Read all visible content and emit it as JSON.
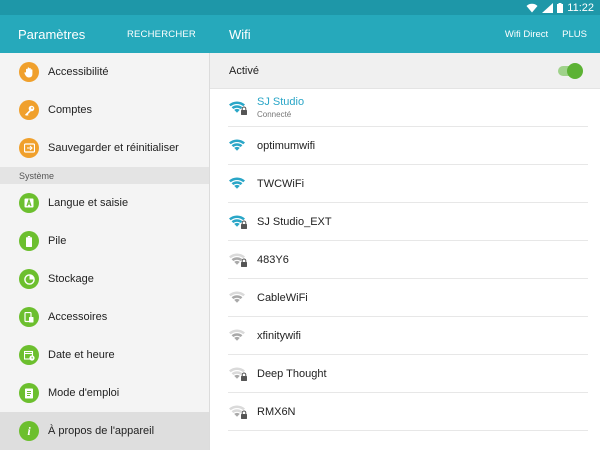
{
  "status_bar": {
    "time": "11:22",
    "bg": "#1e97a8"
  },
  "left_header": {
    "title": "Paramètres",
    "search_label": "RECHERCHER"
  },
  "right_header": {
    "title": "Wifi",
    "wifi_direct_label": "Wifi Direct",
    "more_label": "PLUS"
  },
  "sidebar": {
    "items_top": [
      {
        "label": "Accessibilité",
        "icon": "hand-icon",
        "color": "orange"
      },
      {
        "label": "Comptes",
        "icon": "key-icon",
        "color": "orange"
      },
      {
        "label": "Sauvegarder et réinitialiser",
        "icon": "backup-icon",
        "color": "orange"
      }
    ],
    "section_label": "Système",
    "items_system": [
      {
        "label": "Langue et saisie",
        "icon": "language-icon",
        "color": "green"
      },
      {
        "label": "Pile",
        "icon": "battery-icon",
        "color": "green"
      },
      {
        "label": "Stockage",
        "icon": "storage-icon",
        "color": "green"
      },
      {
        "label": "Accessoires",
        "icon": "accessories-icon",
        "color": "green"
      },
      {
        "label": "Date et heure",
        "icon": "calendar-icon",
        "color": "green"
      },
      {
        "label": "Mode d'emploi",
        "icon": "manual-icon",
        "color": "green"
      },
      {
        "label": "À propos de l'appareil",
        "icon": "info-icon",
        "color": "green",
        "active": true
      }
    ]
  },
  "wifi": {
    "toggle_label": "Activé",
    "enabled": true,
    "networks": [
      {
        "name": "SJ Studio",
        "status": "Connecté",
        "secured": true,
        "strength": 3,
        "connected": true
      },
      {
        "name": "optimumwifi",
        "status": "",
        "secured": false,
        "strength": 3,
        "connected": false
      },
      {
        "name": "TWCWiFi",
        "status": "",
        "secured": false,
        "strength": 3,
        "connected": false
      },
      {
        "name": "SJ Studio_EXT",
        "status": "",
        "secured": true,
        "strength": 3,
        "connected": false
      },
      {
        "name": "483Y6",
        "status": "",
        "secured": true,
        "strength": 2,
        "connected": false
      },
      {
        "name": "CableWiFi",
        "status": "",
        "secured": false,
        "strength": 2,
        "connected": false
      },
      {
        "name": "xfinitywifi",
        "status": "",
        "secured": false,
        "strength": 2,
        "connected": false
      },
      {
        "name": "Deep Thought",
        "status": "",
        "secured": true,
        "strength": 1,
        "connected": false
      },
      {
        "name": "RMX6N",
        "status": "",
        "secured": true,
        "strength": 1,
        "connected": false
      }
    ]
  },
  "colors": {
    "accent": "#26a9bb",
    "orange": "#f0a02c",
    "green": "#6cbf2e",
    "wifi_strong": "#2aa6c7",
    "wifi_weak": "#a9a9a9"
  }
}
